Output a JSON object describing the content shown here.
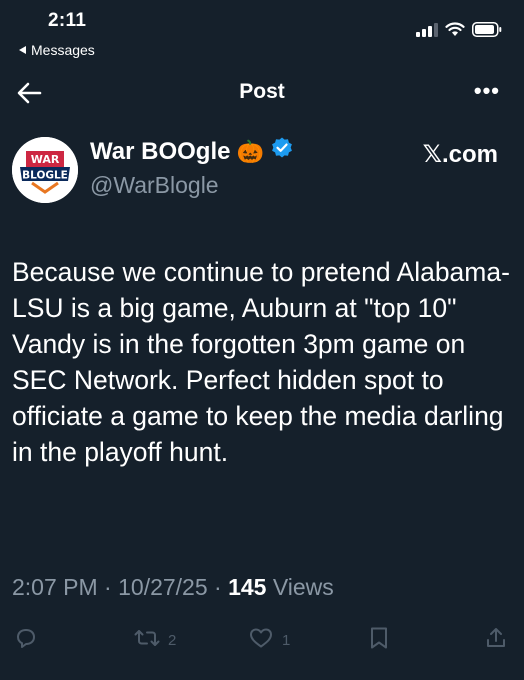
{
  "status_bar": {
    "time": "2:11",
    "back_app": "Messages"
  },
  "header": {
    "title": "Post",
    "more_label": "•••"
  },
  "author": {
    "name": "War BOOgle",
    "emoji": "🎃",
    "handle": "@WarBlogle",
    "avatar_lines": [
      "WAR",
      "BLOGLE"
    ]
  },
  "watermark": "𝕏.com",
  "tweet": {
    "text": "Because we continue to pretend Alabama-LSU is a big game, Auburn at \"top 10\" Vandy is in the forgotten 3pm game on SEC Network. Perfect hidden spot to officiate a game to keep the media darling in the playoff hunt."
  },
  "meta": {
    "time": "2:07 PM",
    "date": "10/27/25",
    "views_count": "145",
    "views_label": "Views",
    "separator": "·"
  },
  "actions": {
    "reposts": "2",
    "likes": "1"
  },
  "colors": {
    "background": "#15202b",
    "muted": "#8b98a5",
    "verified": "#1d9bf0",
    "action_icons": "#4e5b69"
  }
}
